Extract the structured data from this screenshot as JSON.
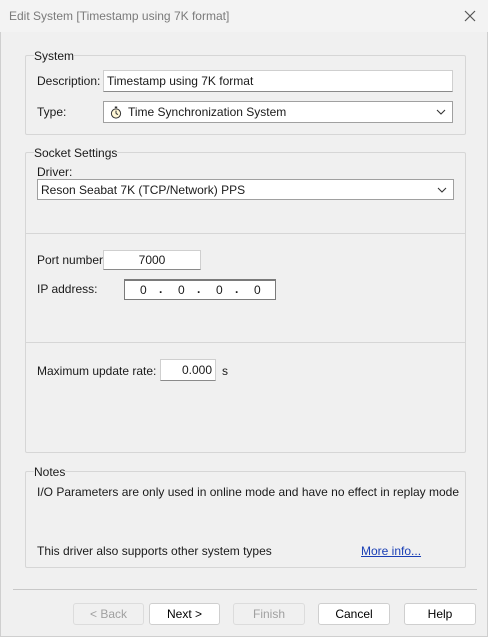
{
  "window": {
    "title": "Edit System [Timestamp using 7K format]",
    "close_icon": "close-icon"
  },
  "system": {
    "group_label": "System",
    "description_label": "Description:",
    "description_value": "Timestamp using 7K format",
    "type_label": "Type:",
    "type_value": "Time Synchronization System",
    "type_icon": "stopwatch-icon"
  },
  "socket": {
    "group_label": "Socket Settings",
    "driver_label": "Driver:",
    "driver_value": "Reson Seabat 7K (TCP/Network) PPS",
    "port_label": "Port number:",
    "port_value": "7000",
    "ip_label": "IP address:",
    "ip_octets": [
      "0",
      "0",
      "0",
      "0"
    ],
    "rate_label": "Maximum update rate:",
    "rate_value": "0.000",
    "rate_unit": "s"
  },
  "notes": {
    "group_label": "Notes",
    "text": "I/O Parameters are only used in online mode and have no effect in replay mode",
    "other_types": "This driver also supports other system types",
    "more_info": "More info..."
  },
  "buttons": {
    "back": "< Back",
    "next": "Next >",
    "finish": "Finish",
    "cancel": "Cancel",
    "help": "Help"
  },
  "colors": {
    "background": "#f0f0f0",
    "link": "#1a3fb5",
    "disabled_text": "#a0a0a0"
  }
}
